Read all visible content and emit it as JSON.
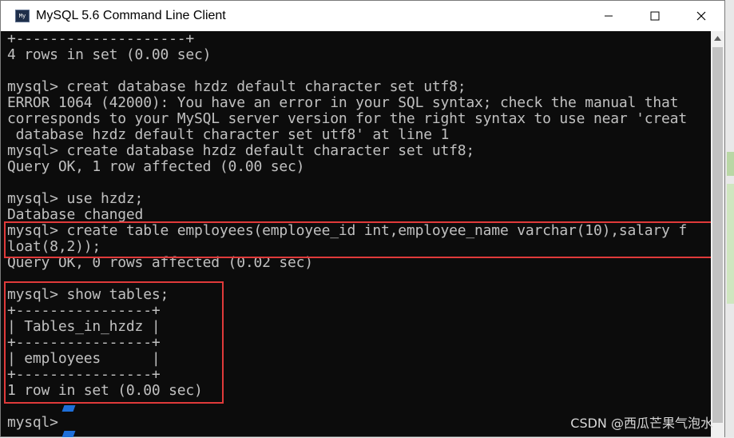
{
  "window": {
    "title": "MySQL 5.6 Command Line Client",
    "icon": "mysql-console-icon"
  },
  "terminal": {
    "lines": [
      "+--------------------+",
      "4 rows in set (0.00 sec)",
      "",
      "mysql> creat database hzdz default character set utf8;",
      "ERROR 1064 (42000): You have an error in your SQL syntax; check the manual that",
      "corresponds to your MySQL server version for the right syntax to use near 'creat",
      " database hzdz default character set utf8' at line 1",
      "mysql> create database hzdz default character set utf8;",
      "Query OK, 1 row affected (0.00 sec)",
      "",
      "mysql> use hzdz;",
      "Database changed",
      "mysql> create table employees(employee_id int,employee_name varchar(10),salary f",
      "loat(8,2));",
      "Query OK, 0 rows affected (0.02 sec)",
      "",
      "mysql> show tables;",
      "+----------------+",
      "| Tables_in_hzdz |",
      "+----------------+",
      "| employees      |",
      "+----------------+",
      "1 row in set (0.00 sec)",
      "",
      "mysql>"
    ]
  },
  "watermark": "CSDN @西瓜芒果气泡水",
  "colors": {
    "terminal_bg": "#0c0c0c",
    "terminal_fg": "#c0c0c0",
    "highlight": "#e03a3a"
  }
}
